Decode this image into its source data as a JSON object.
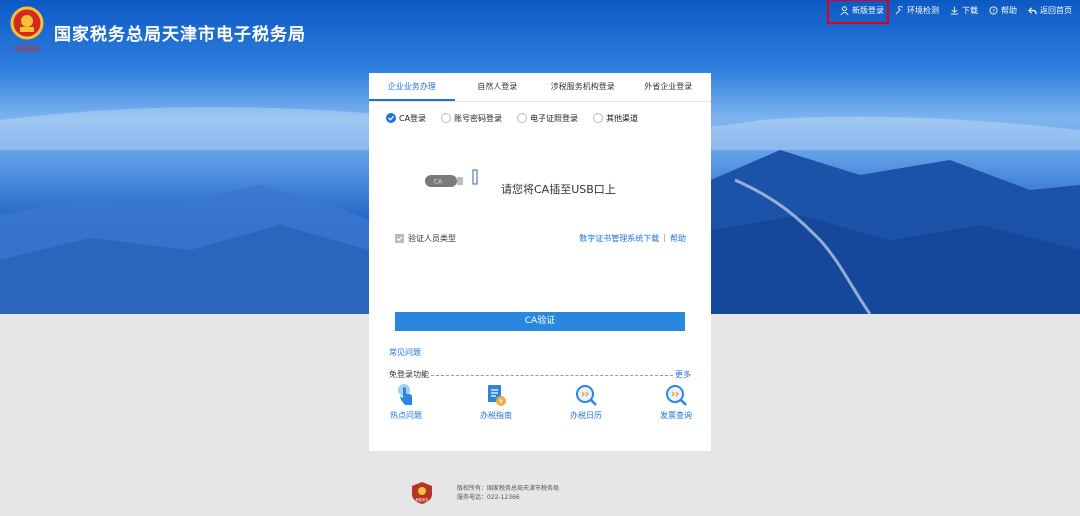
{
  "header": {
    "title": "国家税务总局天津市电子税务局",
    "emblem_caption": "中国税务"
  },
  "topnav": {
    "items": [
      {
        "label": "新版登录",
        "icon": "user-icon"
      },
      {
        "label": "环境检测",
        "icon": "wrench-icon"
      },
      {
        "label": "下载",
        "icon": "download-icon"
      },
      {
        "label": "帮助",
        "icon": "help-icon"
      },
      {
        "label": "返回首页",
        "icon": "back-icon"
      }
    ],
    "highlight_color": "#e0001b"
  },
  "login": {
    "tabs": [
      "企业业务办理",
      "自然人登录",
      "涉税服务机构登录",
      "外省企业登录"
    ],
    "active_tab": 0,
    "methods": [
      "CA登录",
      "账号密码登录",
      "电子证照登录",
      "其他渠道"
    ],
    "selected_method": 0,
    "usb_label": "CA",
    "ca_prompt": "请您将CA插至USB口上",
    "verify_label": "验证人员类型",
    "cert_link": "数字证书管理系统下载",
    "help_link": "帮助",
    "ca_button": "CA验证",
    "faq_link": "常见问题",
    "free_label": "免登录功能",
    "more_link": "更多",
    "shortcuts": [
      {
        "label": "热点问题",
        "icon": "hand-pointer-icon"
      },
      {
        "label": "办税指南",
        "icon": "guide-document-icon"
      },
      {
        "label": "办税日历",
        "icon": "calendar-search-icon"
      },
      {
        "label": "发票查询",
        "icon": "invoice-search-icon"
      }
    ]
  },
  "footer": {
    "copyright": "版权所有：国家税务总局天津市税务局",
    "phone": "服务电话：022-12366",
    "badge_caption": "网络安全"
  },
  "colors": {
    "accent": "#1e73d6",
    "button": "#2a87e0",
    "hero_top": "#0c59c4"
  }
}
